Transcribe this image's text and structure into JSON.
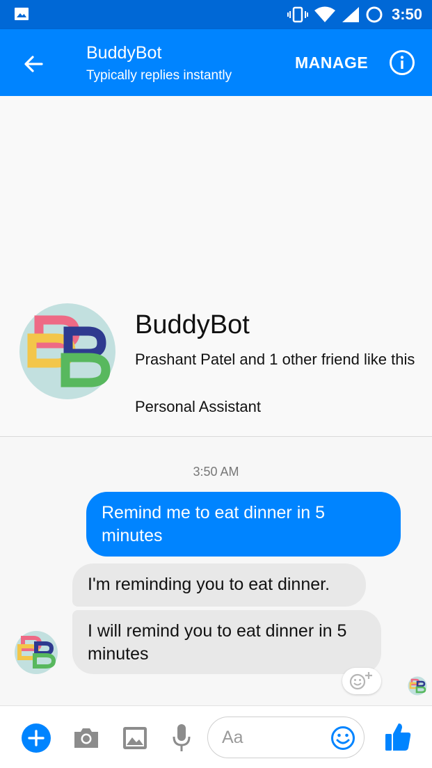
{
  "status_bar": {
    "time": "3:50"
  },
  "header": {
    "title": "BuddyBot",
    "subtitle": "Typically replies instantly",
    "manage_label": "MANAGE"
  },
  "profile": {
    "name": "BuddyBot",
    "likes": "Prashant Patel and 1 other friend like this",
    "category": "Personal Assistant"
  },
  "conversation": {
    "timestamp": "3:50 AM",
    "messages": [
      {
        "from": "user",
        "text": "Remind me to eat dinner in 5 minutes"
      },
      {
        "from": "bot",
        "text": "I'm reminding you to eat dinner."
      },
      {
        "from": "bot",
        "text": "I will remind you to eat dinner in 5 minutes"
      }
    ]
  },
  "composer": {
    "placeholder": "Aa"
  },
  "colors": {
    "brand_blue": "#0084ff",
    "status_bar": "#0068d6",
    "bot_bubble": "#e8e8e8"
  },
  "icons": [
    "image-icon",
    "vibrate-icon",
    "wifi-icon",
    "signal-icon",
    "sync-icon",
    "back-arrow-icon",
    "info-icon",
    "plus-icon",
    "camera-icon",
    "gallery-icon",
    "mic-icon",
    "emoji-icon",
    "thumbs-up-icon",
    "add-reaction-icon"
  ]
}
